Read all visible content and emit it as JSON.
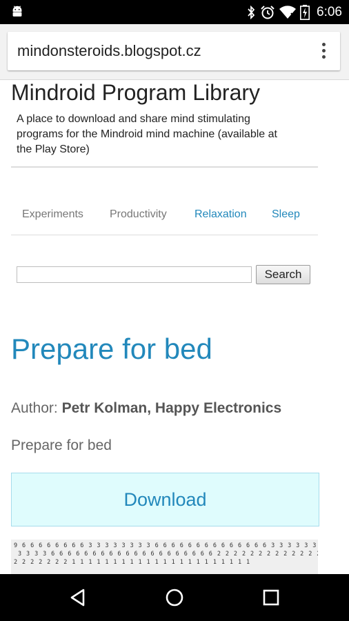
{
  "status_bar": {
    "time": "6:06",
    "icons": [
      "android-icon",
      "bluetooth-icon",
      "alarm-icon",
      "wifi-icon",
      "battery-charging-icon"
    ]
  },
  "browser": {
    "url": "mindonsteroids.blogspot.cz",
    "menu_icon": "overflow-menu-icon"
  },
  "page": {
    "blog_title": "Mindroid Program Library",
    "blog_description": "A place to download and share mind stimulating programs for the Mindroid mind machine (available at the Play Store)",
    "nav": [
      {
        "label": "Experiments",
        "active": false
      },
      {
        "label": "Productivity",
        "active": false
      },
      {
        "label": "Relaxation",
        "active": true
      },
      {
        "label": "Sleep",
        "active": true
      }
    ],
    "search": {
      "value": "",
      "button_label": "Search"
    },
    "post": {
      "title": "Prepare for bed",
      "author_label": "Author:",
      "author_name": "Petr Kolman, Happy Electronics",
      "body": "Prepare for bed",
      "download_label": "Download",
      "code_lines": [
        "9 6 6 6 6 6 6 6 6 3 3 3 3 3 3 3 3 6 6 6 6 6 6 6 6 6 6 6 6 6 6 3 3 3 3 3 3 3 3 3",
        "3 3 3 3 6 6 6 6 6 6 6 6 6 6 6 6 6 6 6 6 6 6 6 6 2 2 2 2 2 2 2 2 2 2 2 2 2 2 2",
        "2 2 2 2 2 2 2 1 1 1 1 1 1 1 1 1 1 1 1 1 1 1 1 1 1 1 1 1 1"
      ]
    }
  },
  "system_nav": {
    "icons": [
      "back-icon",
      "home-icon",
      "recents-icon"
    ]
  },
  "colors": {
    "link": "#2288bb",
    "download_bg": "#dffcfd",
    "status_bar": "#000000"
  }
}
